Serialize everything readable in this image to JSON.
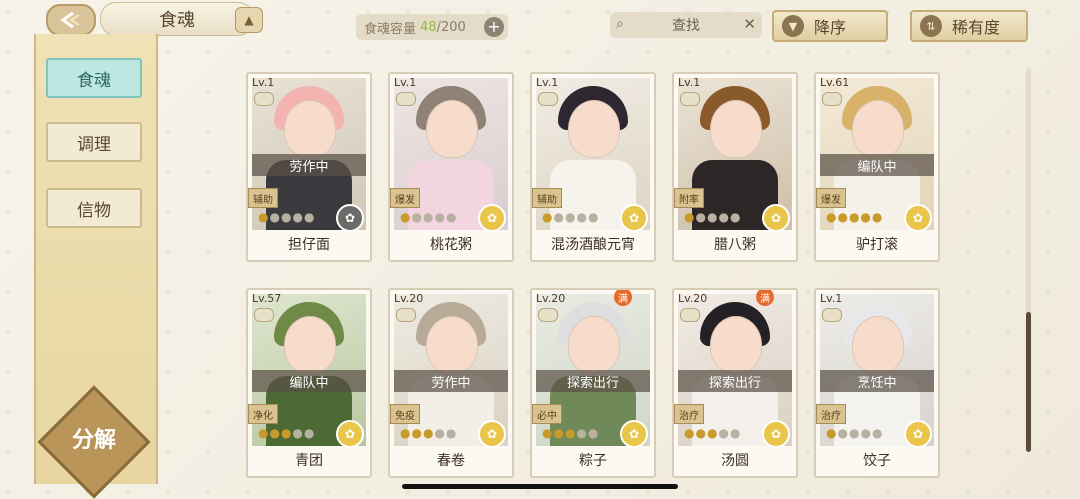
{
  "header": {
    "title": "食魂",
    "capacity_label": "食魂容量",
    "capacity_current": "48",
    "capacity_max": "/200",
    "search_label": "查找",
    "sort_desc_label": "降序",
    "sort_rarity_label": "稀有度"
  },
  "sidebar": {
    "items": [
      {
        "label": "食魂"
      },
      {
        "label": "调理"
      },
      {
        "label": "信物"
      }
    ],
    "decompose_label": "分解"
  },
  "cards": [
    {
      "level": "Lv.1",
      "status": "劳作中",
      "type": "辅助",
      "name": "担仔面",
      "stars": 5,
      "lit": 1,
      "colors": [
        "#e9e2d5",
        "#cfc6b6"
      ],
      "hair": "#f3b3b0",
      "cloth": "#3b3a3e",
      "fav": "dark",
      "full": ""
    },
    {
      "level": "Lv.1",
      "status": "",
      "type": "爆发",
      "name": "桃花粥",
      "stars": 5,
      "lit": 1,
      "colors": [
        "#eee6e2",
        "#d8cdd0"
      ],
      "hair": "#8f8176",
      "cloth": "#f2d5df",
      "fav": "gold",
      "full": ""
    },
    {
      "level": "Lv.1",
      "status": "",
      "type": "辅助",
      "name": "混汤酒酿元宵",
      "stars": 5,
      "lit": 1,
      "colors": [
        "#f1ece4",
        "#ddd4c4"
      ],
      "hair": "#2e2630",
      "cloth": "#f6f2ec",
      "fav": "gold",
      "full": ""
    },
    {
      "level": "Lv.1",
      "status": "",
      "type": "附率",
      "name": "腊八粥",
      "stars": 5,
      "lit": 1,
      "colors": [
        "#ece3d6",
        "#cdbfa8"
      ],
      "hair": "#8a5a2a",
      "cloth": "#2c2626",
      "fav": "gold",
      "full": ""
    },
    {
      "level": "Lv.61",
      "status": "编队中",
      "type": "爆发",
      "name": "驴打滚",
      "stars": 5,
      "lit": 5,
      "colors": [
        "#f3ead8",
        "#e2d4b8"
      ],
      "hair": "#d9b26a",
      "cloth": "#f5f1e8",
      "fav": "gold",
      "full": ""
    },
    {
      "level": "Lv.57",
      "status": "编队中",
      "type": "净化",
      "name": "青团",
      "stars": 5,
      "lit": 3,
      "colors": [
        "#dfe5cf",
        "#b8c7a0"
      ],
      "hair": "#6f8a46",
      "cloth": "#4d6a34",
      "fav": "gold",
      "full": ""
    },
    {
      "level": "Lv.20",
      "status": "劳作中",
      "type": "免疫",
      "name": "春卷",
      "stars": 5,
      "lit": 3,
      "colors": [
        "#efebe2",
        "#d9d1c2"
      ],
      "hair": "#b7ab98",
      "cloth": "#f4efe6",
      "fav": "gold",
      "full": ""
    },
    {
      "level": "Lv.20",
      "status": "探索出行",
      "type": "必中",
      "name": "粽子",
      "stars": 5,
      "lit": 3,
      "colors": [
        "#e9ebe2",
        "#cfd6c6"
      ],
      "hair": "#dedede",
      "cloth": "#6f8a58",
      "fav": "gold",
      "full": "满"
    },
    {
      "level": "Lv.20",
      "status": "探索出行",
      "type": "治疗",
      "name": "汤圆",
      "stars": 5,
      "lit": 3,
      "colors": [
        "#f1ebe4",
        "#dad0c4"
      ],
      "hair": "#232026",
      "cloth": "#f3efea",
      "fav": "gold",
      "full": "满"
    },
    {
      "level": "Lv.1",
      "status": "烹饪中",
      "type": "治疗",
      "name": "饺子",
      "stars": 5,
      "lit": 1,
      "colors": [
        "#eeece8",
        "#d6d3cc"
      ],
      "hair": "#e8e8ea",
      "cloth": "#f5f3ef",
      "fav": "gold",
      "full": ""
    }
  ]
}
